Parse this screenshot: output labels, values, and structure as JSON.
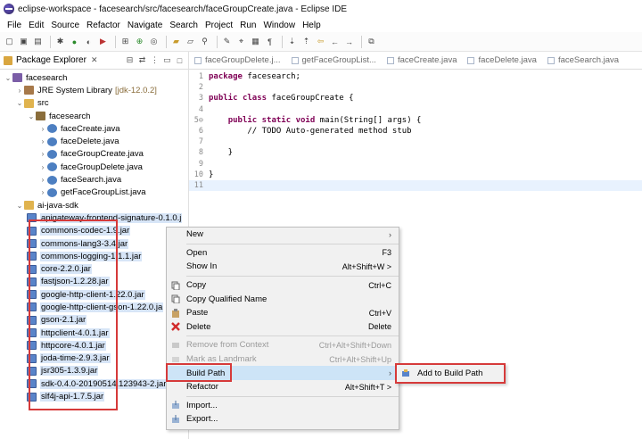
{
  "window": {
    "title": "eclipse-workspace - facesearch/src/facesearch/faceGroupCreate.java - Eclipse IDE"
  },
  "menubar": [
    "File",
    "Edit",
    "Source",
    "Refactor",
    "Navigate",
    "Search",
    "Project",
    "Run",
    "Window",
    "Help"
  ],
  "explorer": {
    "tab_label": "Package Explorer",
    "tree": [
      {
        "indent": 0,
        "arrow": "v",
        "icon": "project",
        "label": "facesearch",
        "extra": ""
      },
      {
        "indent": 1,
        "arrow": ">",
        "icon": "lib",
        "label": "JRE System Library",
        "extra": "[jdk-12.0.2]"
      },
      {
        "indent": 1,
        "arrow": "v",
        "icon": "folder",
        "label": "src",
        "extra": ""
      },
      {
        "indent": 2,
        "arrow": "v",
        "icon": "pkg",
        "label": "facesearch",
        "extra": ""
      },
      {
        "indent": 3,
        "arrow": ">",
        "icon": "java",
        "label": "faceCreate.java",
        "extra": ""
      },
      {
        "indent": 3,
        "arrow": ">",
        "icon": "java",
        "label": "faceDelete.java",
        "extra": ""
      },
      {
        "indent": 3,
        "arrow": ">",
        "icon": "java",
        "label": "faceGroupCreate.java",
        "extra": ""
      },
      {
        "indent": 3,
        "arrow": ">",
        "icon": "java",
        "label": "faceGroupDelete.java",
        "extra": ""
      },
      {
        "indent": 3,
        "arrow": ">",
        "icon": "java",
        "label": "faceSearch.java",
        "extra": ""
      },
      {
        "indent": 3,
        "arrow": ">",
        "icon": "java",
        "label": "getFaceGroupList.java",
        "extra": ""
      },
      {
        "indent": 1,
        "arrow": "v",
        "icon": "folder",
        "label": "ai-java-sdk",
        "extra": ""
      }
    ],
    "jars": [
      "apigateway-frontend-signature-0.1.0.j",
      "commons-codec-1.9.jar",
      "commons-lang3-3.4.jar",
      "commons-logging-1.1.1.jar",
      "core-2.2.0.jar",
      "fastjson-1.2.28.jar",
      "google-http-client-1.22.0.jar",
      "google-http-client-gson-1.22.0.ja",
      "gson-2.1.jar",
      "httpclient-4.0.1.jar",
      "httpcore-4.0.1.jar",
      "joda-time-2.9.3.jar",
      "jsr305-1.3.9.jar",
      "sdk-0.4.0-20190514.123943-2.jar",
      "slf4j-api-1.7.5.jar"
    ]
  },
  "editor": {
    "tabs": [
      "faceGroupDelete.j...",
      "getFaceGroupList...",
      "faceCreate.java",
      "faceDelete.java",
      "faceSearch.java"
    ],
    "lines": [
      {
        "n": "1",
        "text": "package facesearch;"
      },
      {
        "n": "2",
        "text": ""
      },
      {
        "n": "3",
        "text": "public class faceGroupCreate {"
      },
      {
        "n": "4",
        "text": ""
      },
      {
        "n": "5⊖",
        "text": "    public static void main(String[] args) {"
      },
      {
        "n": "6",
        "text": "        // TODO Auto-generated method stub"
      },
      {
        "n": "7",
        "text": ""
      },
      {
        "n": "8",
        "text": "    }"
      },
      {
        "n": "9",
        "text": ""
      },
      {
        "n": "10",
        "text": "}"
      },
      {
        "n": "11",
        "text": ""
      }
    ]
  },
  "context_menu": {
    "items": [
      {
        "label": "New",
        "shortcut": "",
        "submenu": true,
        "disabled": false,
        "icon": ""
      },
      {
        "sep": true
      },
      {
        "label": "Open",
        "shortcut": "F3",
        "submenu": false,
        "disabled": false,
        "icon": ""
      },
      {
        "label": "Show In",
        "shortcut": "Alt+Shift+W >",
        "submenu": false,
        "disabled": false,
        "icon": ""
      },
      {
        "sep": true
      },
      {
        "label": "Copy",
        "shortcut": "Ctrl+C",
        "submenu": false,
        "disabled": false,
        "icon": "copy"
      },
      {
        "label": "Copy Qualified Name",
        "shortcut": "",
        "submenu": false,
        "disabled": false,
        "icon": "copy"
      },
      {
        "label": "Paste",
        "shortcut": "Ctrl+V",
        "submenu": false,
        "disabled": false,
        "icon": "paste"
      },
      {
        "label": "Delete",
        "shortcut": "Delete",
        "submenu": false,
        "disabled": false,
        "icon": "delete"
      },
      {
        "sep": true
      },
      {
        "label": "Remove from Context",
        "shortcut": "Ctrl+Alt+Shift+Down",
        "submenu": false,
        "disabled": true,
        "icon": "remove"
      },
      {
        "label": "Mark as Landmark",
        "shortcut": "Ctrl+Alt+Shift+Up",
        "submenu": false,
        "disabled": true,
        "icon": "landmark"
      },
      {
        "label": "Build Path",
        "shortcut": "",
        "submenu": true,
        "disabled": false,
        "icon": "",
        "active": true
      },
      {
        "label": "Refactor",
        "shortcut": "Alt+Shift+T >",
        "submenu": false,
        "disabled": false,
        "icon": ""
      },
      {
        "sep": true
      },
      {
        "label": "Import...",
        "shortcut": "",
        "submenu": false,
        "disabled": false,
        "icon": "import"
      },
      {
        "label": "Export...",
        "shortcut": "",
        "submenu": false,
        "disabled": false,
        "icon": "export"
      }
    ],
    "submenu_label": "Add to Build Path"
  },
  "colors": {
    "highlight_red": "#d63a3a",
    "selection_blue": "#cde4f7"
  }
}
